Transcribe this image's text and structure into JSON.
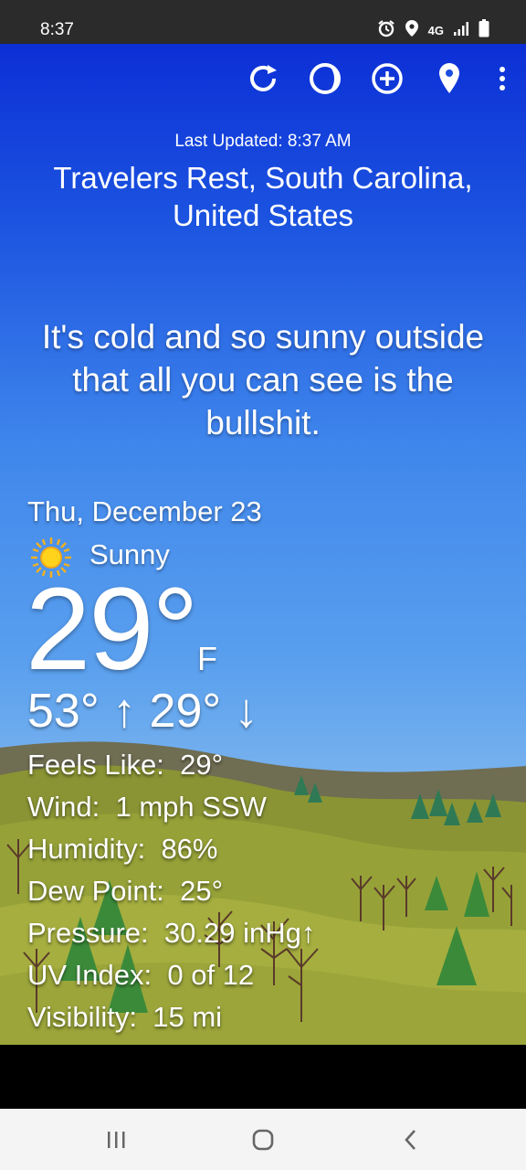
{
  "status_bar": {
    "time": "8:37",
    "network": "4G",
    "icons": [
      "alarm-icon",
      "location-icon",
      "4g-icon",
      "signal-icon",
      "battery-icon"
    ]
  },
  "toolbar": {
    "actions": [
      "refresh-icon",
      "theme-icon",
      "add-location-icon",
      "location-pin-icon",
      "more-vert-icon"
    ]
  },
  "header": {
    "last_updated": "Last Updated: 8:37 AM",
    "location": "Travelers Rest, South Carolina, United States"
  },
  "quip": "It's cold and so sunny outside that all you can see is the bullshit.",
  "current": {
    "date": "Thu, December 23",
    "condition": "Sunny",
    "condition_icon": "sun-icon",
    "temperature": "29°",
    "unit": "F",
    "hi_lo": "53° ↑ 29° ↓"
  },
  "details": [
    {
      "label": "Feels Like:",
      "value": "29°"
    },
    {
      "label": "Wind:",
      "value": "1 mph SSW"
    },
    {
      "label": "Humidity:",
      "value": "86%"
    },
    {
      "label": "Dew Point:",
      "value": "25°"
    },
    {
      "label": "Pressure:",
      "value": "30.29 inHg↑"
    },
    {
      "label": "UV Index:",
      "value": "0 of 12"
    },
    {
      "label": "Visibility:",
      "value": "15 mi"
    }
  ],
  "nav": [
    "recent-apps-icon",
    "home-icon",
    "back-icon"
  ],
  "colors": {
    "sky_top": "#0c2fd6",
    "sky_bottom": "#9dc4ec",
    "hills": "#8f9a2f",
    "status_bar": "#2b2b2b",
    "nav_bar": "#f4f4f4"
  }
}
